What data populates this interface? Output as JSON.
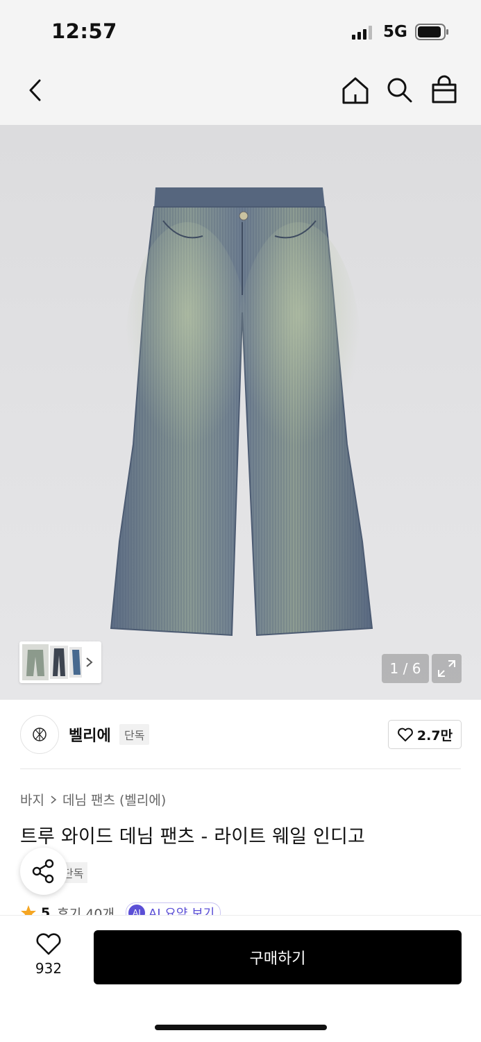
{
  "status_bar": {
    "time": "12:57",
    "network": "5G"
  },
  "nav": {
    "icons": [
      "back-icon",
      "home-icon",
      "search-icon",
      "shopping-bag-icon"
    ]
  },
  "gallery": {
    "counter": "1 / 6",
    "expand_icon": "expand-icon"
  },
  "brand": {
    "name": "벨리에",
    "badge": "단독",
    "likes": "2.7만"
  },
  "product": {
    "breadcrumb": [
      "바지",
      "데님 팬츠 (벨리에)"
    ],
    "title": "트루 와이드 데님 팬츠 - 라이트 웨일 인디고",
    "tag": "단독",
    "rating": "5",
    "reviews": "후기 40개",
    "ai_summary": "AI 요약 보기"
  },
  "bottom": {
    "wish_count": "932",
    "buy_label": "구매하기"
  },
  "colors": {
    "accent": "#000000",
    "star": "#f5a623",
    "ai": "#5b4fd6"
  }
}
